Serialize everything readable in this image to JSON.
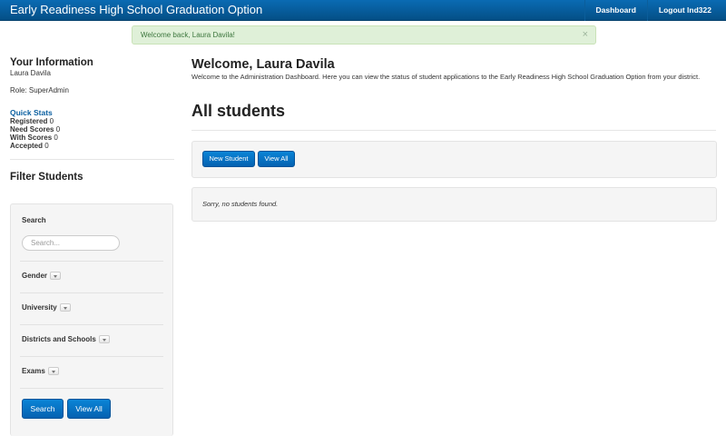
{
  "navbar": {
    "brand": "Early Readiness High School Graduation Option",
    "links": [
      "Dashboard",
      "Logout lnd322"
    ]
  },
  "alert": {
    "message": "Welcome back, Laura Davila!",
    "close_symbol": "×"
  },
  "sidebar": {
    "your_info_title": "Your Information",
    "name": "Laura Davila",
    "role": "Role: SuperAdmin",
    "quick_stats_title": "Quick Stats",
    "stats": [
      {
        "label": "Registered",
        "value": "0"
      },
      {
        "label": "Need Scores",
        "value": "0"
      },
      {
        "label": "With Scores",
        "value": "0"
      },
      {
        "label": "Accepted",
        "value": "0"
      }
    ],
    "filter_title": "Filter Students"
  },
  "filter": {
    "search_label": "Search",
    "search_placeholder": "Search...",
    "gender_label": "Gender",
    "university_label": "University",
    "districts_label": "Districts and Schools",
    "exams_label": "Exams",
    "search_button": "Search",
    "view_all_button": "View All"
  },
  "main": {
    "welcome": "Welcome, Laura Davila",
    "intro": "Welcome to the Administration Dashboard. Here you can view the status of student applications to the Early Readiness High School Graduation Option from your district.",
    "heading": "All students",
    "new_student_button": "New Student",
    "view_all_button": "View All",
    "empty_message": "Sorry, no students found."
  }
}
